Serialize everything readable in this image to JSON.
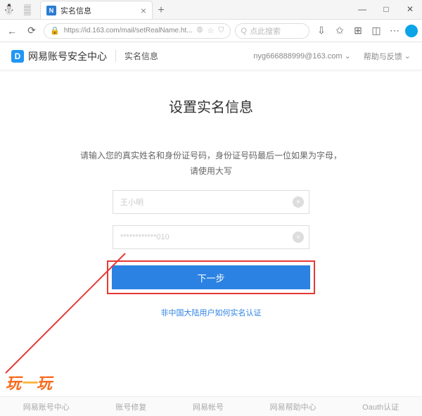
{
  "browser": {
    "tab_title": "实名信息",
    "tab_close": "×",
    "newtab": "+",
    "url": "https://id.163.com/mail/setRealName.ht...",
    "search_placeholder": "点此搜索",
    "window": {
      "min": "—",
      "max": "□",
      "close": "✕"
    }
  },
  "header": {
    "logo_text": "网易账号安全中心",
    "breadcrumb": "实名信息",
    "user_email": "nyg666888999@163.com",
    "help_label": "帮助与反馈"
  },
  "page": {
    "title": "设置实名信息",
    "instruction_line1": "请输入您的真实姓名和身份证号码，身份证号码最后一位如果为字母，",
    "instruction_line2": "请使用大写",
    "name_value": "王小明",
    "id_value": "************010",
    "submit_label": "下一步",
    "help_link": "非中国大陆用户如何实名认证"
  },
  "footer": {
    "links": [
      "网易账号中心",
      "账号修复",
      "网易帐号",
      "网易帮助中心",
      "Oauth认证"
    ]
  },
  "watermark": {
    "t1": "玩",
    "t2": "一",
    "t3": "玩"
  }
}
